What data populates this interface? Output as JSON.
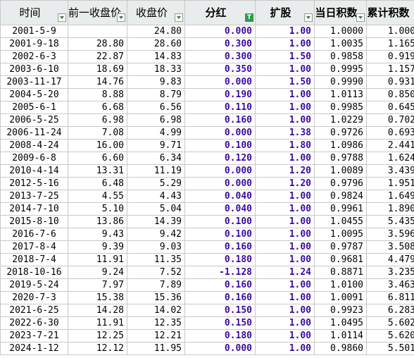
{
  "headers": [
    "时间",
    "前一收盘价",
    "收盘价",
    "分红",
    "扩股",
    "当日积数",
    "累计积数"
  ],
  "filter_icon_label": "T",
  "rows": [
    [
      "2001-5-9",
      "",
      "24.80",
      "0.000",
      "1.00",
      "1.0000",
      "1.000"
    ],
    [
      "2001-9-18",
      "28.80",
      "28.60",
      "0.300",
      "1.00",
      "1.0035",
      "1.165"
    ],
    [
      "2002-6-3",
      "22.87",
      "14.83",
      "0.300",
      "1.50",
      "0.9858",
      "0.919"
    ],
    [
      "2003-6-10",
      "18.69",
      "18.33",
      "0.350",
      "1.00",
      "0.9995",
      "1.157"
    ],
    [
      "2003-11-17",
      "14.76",
      "9.83",
      "0.000",
      "1.50",
      "0.9990",
      "0.931"
    ],
    [
      "2004-5-20",
      "8.88",
      "8.79",
      "0.190",
      "1.00",
      "1.0113",
      "0.850"
    ],
    [
      "2005-6-1",
      "6.68",
      "6.56",
      "0.110",
      "1.00",
      "0.9985",
      "0.645"
    ],
    [
      "2006-5-25",
      "6.98",
      "6.98",
      "0.160",
      "1.00",
      "1.0229",
      "0.702"
    ],
    [
      "2006-11-24",
      "7.08",
      "4.99",
      "0.000",
      "1.38",
      "0.9726",
      "0.693"
    ],
    [
      "2008-4-24",
      "16.00",
      "9.71",
      "0.100",
      "1.80",
      "1.0986",
      "2.441"
    ],
    [
      "2009-6-8",
      "6.60",
      "6.34",
      "0.120",
      "1.00",
      "0.9788",
      "1.624"
    ],
    [
      "2010-4-14",
      "13.31",
      "11.19",
      "0.000",
      "1.20",
      "1.0089",
      "3.439"
    ],
    [
      "2012-5-16",
      "6.48",
      "5.29",
      "0.000",
      "1.20",
      "0.9796",
      "1.951"
    ],
    [
      "2013-7-25",
      "4.55",
      "4.43",
      "0.040",
      "1.00",
      "0.9824",
      "1.649"
    ],
    [
      "2014-7-10",
      "5.10",
      "5.04",
      "0.040",
      "1.00",
      "0.9961",
      "1.890"
    ],
    [
      "2015-8-10",
      "13.86",
      "14.39",
      "0.100",
      "1.00",
      "1.0455",
      "5.435"
    ],
    [
      "2016-7-6",
      "9.43",
      "9.42",
      "0.100",
      "1.00",
      "1.0095",
      "3.596"
    ],
    [
      "2017-8-4",
      "9.39",
      "9.03",
      "0.160",
      "1.00",
      "0.9787",
      "3.508"
    ],
    [
      "2018-7-4",
      "11.91",
      "11.35",
      "0.180",
      "1.00",
      "0.9681",
      "4.479"
    ],
    [
      "2018-10-16",
      "9.24",
      "7.52",
      "-1.128",
      "1.24",
      "0.8871",
      "3.235"
    ],
    [
      "2019-5-24",
      "7.97",
      "7.89",
      "0.160",
      "1.00",
      "1.0100",
      "3.463"
    ],
    [
      "2020-7-3",
      "15.38",
      "15.36",
      "0.160",
      "1.00",
      "1.0091",
      "6.811"
    ],
    [
      "2021-6-25",
      "14.28",
      "14.02",
      "0.150",
      "1.00",
      "0.9923",
      "6.283"
    ],
    [
      "2022-6-30",
      "11.91",
      "12.35",
      "0.150",
      "1.00",
      "1.0495",
      "5.602"
    ],
    [
      "2023-7-21",
      "12.25",
      "12.21",
      "0.180",
      "1.00",
      "1.0114",
      "5.620"
    ],
    [
      "2024-1-12",
      "12.12",
      "11.95",
      "0.000",
      "1.00",
      "0.9860",
      "5.501"
    ]
  ]
}
